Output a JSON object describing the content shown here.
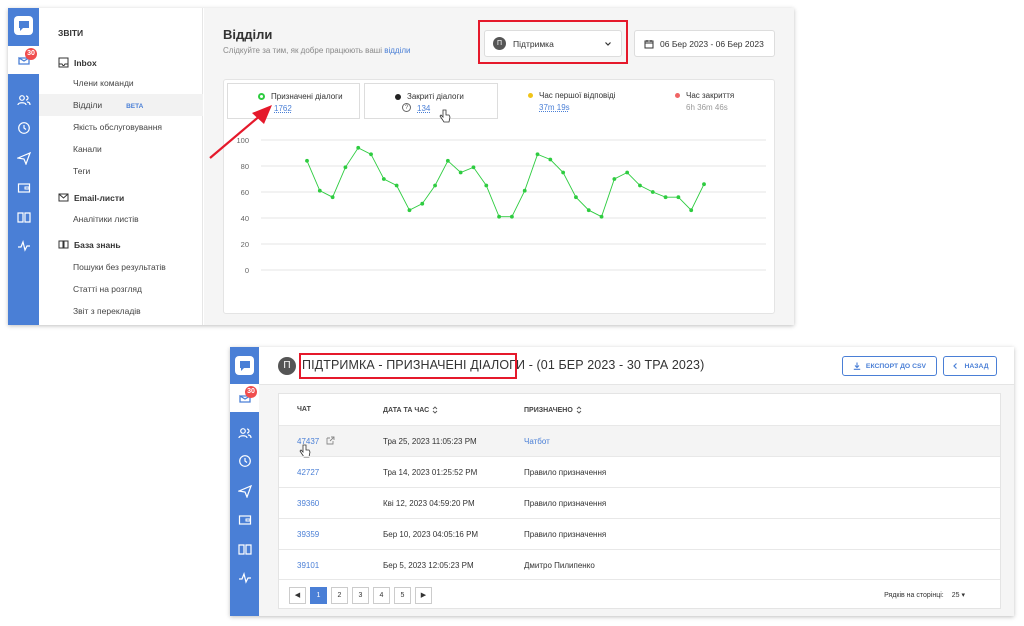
{
  "icons": {
    "logo": "chat-logo-icon",
    "rail": [
      "inbox-icon",
      "users-icon",
      "clock-icon",
      "send-icon",
      "wallet-icon",
      "book-icon",
      "activity-icon"
    ]
  },
  "colors": {
    "accent": "#4a7fd6",
    "highlight": "#e5192b",
    "series": "#2ecc40",
    "badge": "#f04d4d"
  },
  "shot1": {
    "rail_badge": "30",
    "menu": {
      "header": "ЗВІТИ",
      "sections": [
        {
          "label": "Inbox",
          "icon": "inbox-tray-icon",
          "items": [
            {
              "label": "Члени команди"
            },
            {
              "label": "Відділи",
              "badge": "BETA",
              "active": true
            },
            {
              "label": "Якість обслуговування"
            },
            {
              "label": "Канали"
            },
            {
              "label": "Теги"
            }
          ]
        },
        {
          "label": "Email-листи",
          "icon": "envelope-icon",
          "items": [
            {
              "label": "Аналітики листів"
            }
          ]
        },
        {
          "label": "База знань",
          "icon": "open-book-icon",
          "items": [
            {
              "label": "Пошуки без результатів"
            },
            {
              "label": "Статті на розгляд"
            },
            {
              "label": "Звіт з перекладів"
            }
          ]
        }
      ]
    },
    "page": {
      "title": "Відділи",
      "subtitle": "Слідкуйте за тим, як добре працюють ваші",
      "subtitle_link": "відділи"
    },
    "department_select": {
      "avatar": "П",
      "value": "Підтримка"
    },
    "date_range": "06 Бер 2023 - 06 Бер 2023",
    "metrics": [
      {
        "label": "Призначені діалоги",
        "value": "1762",
        "dot": "#2ecc40",
        "ring": true
      },
      {
        "label": "Закриті діалоги",
        "value": "134",
        "dot": "#222222",
        "help": "?"
      },
      {
        "label": "Час першої відповіді",
        "value": "37m 19s",
        "dot": "#f0c419"
      },
      {
        "label": "Час закриття",
        "value": "6h 36m 46s",
        "dot": "#f06464"
      }
    ]
  },
  "chart_data": {
    "type": "line",
    "title": "",
    "xlabel": "",
    "ylabel": "",
    "ylim": [
      0,
      100
    ],
    "yticks": [
      0,
      20,
      40,
      60,
      80,
      100
    ],
    "grid": true,
    "series": [
      {
        "values": [
          84,
          61,
          56,
          79,
          94,
          89,
          70,
          65,
          46,
          51,
          65,
          84,
          75,
          79,
          65,
          41,
          41,
          61,
          89,
          85,
          75,
          56,
          46,
          41,
          70,
          75,
          65,
          60,
          56,
          56,
          46,
          66
        ]
      }
    ]
  },
  "shot2": {
    "rail_badge": "30",
    "header": {
      "avatar": "П",
      "title_highlight": "ПІДТРИМКА - ПРИЗНАЧЕНІ ДІАЛОГИ",
      "title_rest": " - (01 БЕР 2023 - 30 ТРА 2023)",
      "export_label": "ЕКСПОРТ ДО CSV",
      "back_label": "НАЗАД"
    },
    "table": {
      "columns": [
        "ЧАТ",
        "ДАТА ТА ЧАС",
        "ПРИЗНАЧЕНО"
      ],
      "rows": [
        {
          "chat": "47437",
          "date": "Тра 25, 2023   11:05:23 PM",
          "assigned": "Чатбот",
          "assigned_link": true
        },
        {
          "chat": "42727",
          "date": "Тра 14, 2023   01:25:52 PM",
          "assigned": "Правило призначення"
        },
        {
          "chat": "39360",
          "date": "Кві 12, 2023   04:59:20 PM",
          "assigned": "Правило призначення"
        },
        {
          "chat": "39359",
          "date": "Бер 10, 2023   04:05:16 PM",
          "assigned": "Правило призначення"
        },
        {
          "chat": "39101",
          "date": "Бер 5, 2023   12:05:23 PM",
          "assigned": "Дмитро Пилипенко"
        }
      ]
    },
    "pagination": {
      "pages": [
        "1",
        "2",
        "3",
        "4",
        "5"
      ],
      "active": "1"
    },
    "rows_per_page_label": "Рядків на сторінці:",
    "rows_per_page_value": "25"
  }
}
